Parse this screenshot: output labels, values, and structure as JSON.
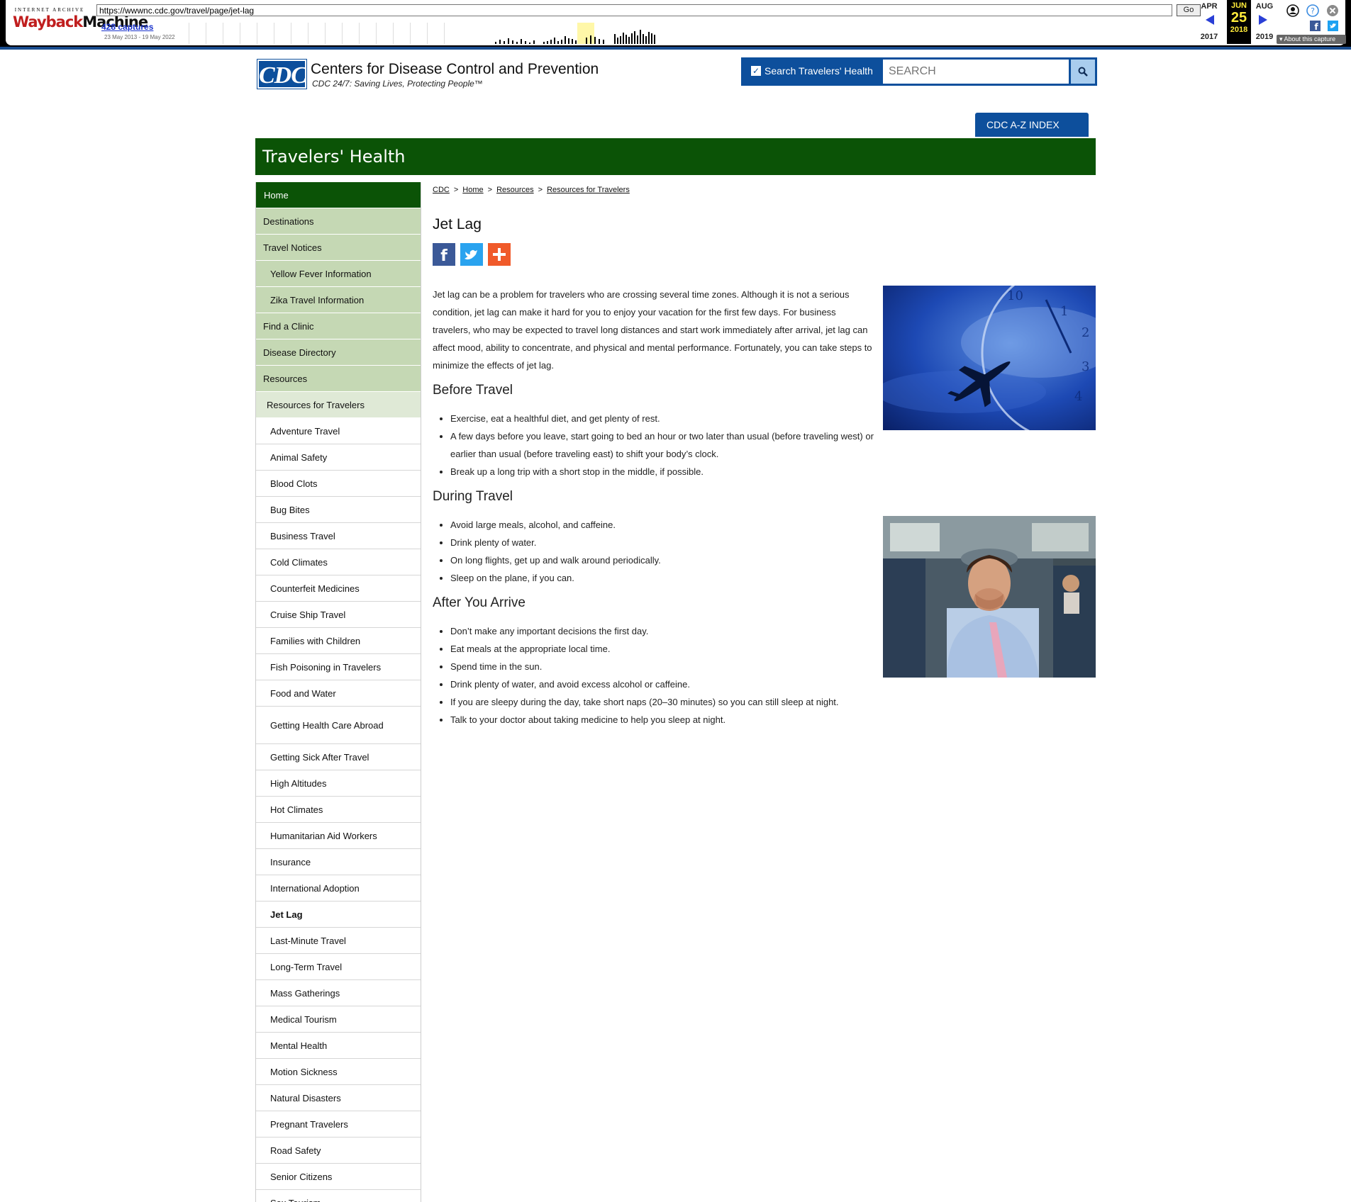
{
  "wayback": {
    "logo_top": "INTERNET ARCHIVE",
    "logo_wayback": "Wayback",
    "logo_machine": "Machine",
    "url": "https://wwwnc.cdc.gov/travel/page/jet-lag",
    "go_label": "Go",
    "captures": "428 captures",
    "range": "23 May 2013 - 19 May 2022",
    "prev_month": "APR",
    "cur_month": "JUN",
    "next_month": "AUG",
    "cur_day": "25",
    "prev_year": "2017",
    "cur_year": "2018",
    "next_year": "2019",
    "about": "About this capture"
  },
  "header": {
    "logo": "CDC",
    "title": "Centers for Disease Control and Prevention",
    "tagline": "CDC 24/7: Saving Lives, Protecting People™",
    "search_checkbox_label": "Search Travelers' Health",
    "search_placeholder": "SEARCH",
    "az_index": "CDC A-Z INDEX",
    "banner": "Travelers' Health"
  },
  "nav": [
    {
      "label": "Home",
      "level": "l1a"
    },
    {
      "label": "Destinations",
      "level": "l1"
    },
    {
      "label": "Travel Notices",
      "level": "l1"
    },
    {
      "label": "Yellow Fever Information",
      "level": "l2"
    },
    {
      "label": "Zika Travel Information",
      "level": "l2"
    },
    {
      "label": "Find a Clinic",
      "level": "l1"
    },
    {
      "label": "Disease Directory",
      "level": "l1"
    },
    {
      "label": "Resources",
      "level": "l1"
    },
    {
      "label": "Resources for Travelers",
      "level": "l2b"
    },
    {
      "label": "Adventure Travel",
      "level": "l3"
    },
    {
      "label": "Animal Safety",
      "level": "l3"
    },
    {
      "label": "Blood Clots",
      "level": "l3"
    },
    {
      "label": "Bug Bites",
      "level": "l3"
    },
    {
      "label": "Business Travel",
      "level": "l3"
    },
    {
      "label": "Cold Climates",
      "level": "l3"
    },
    {
      "label": "Counterfeit Medicines",
      "level": "l3"
    },
    {
      "label": "Cruise Ship Travel",
      "level": "l3"
    },
    {
      "label": "Families with Children",
      "level": "l3"
    },
    {
      "label": "Fish Poisoning in Travelers",
      "level": "l3"
    },
    {
      "label": "Food and Water",
      "level": "l3"
    },
    {
      "label": "Getting Health Care Abroad",
      "level": "l3 tall"
    },
    {
      "label": "Getting Sick After Travel",
      "level": "l3"
    },
    {
      "label": "High Altitudes",
      "level": "l3"
    },
    {
      "label": "Hot Climates",
      "level": "l3"
    },
    {
      "label": "Humanitarian Aid Workers",
      "level": "l3"
    },
    {
      "label": "Insurance",
      "level": "l3"
    },
    {
      "label": "International Adoption",
      "level": "l3"
    },
    {
      "label": "Jet Lag",
      "level": "l3 cur"
    },
    {
      "label": "Last-Minute Travel",
      "level": "l3"
    },
    {
      "label": "Long-Term Travel",
      "level": "l3"
    },
    {
      "label": "Mass Gatherings",
      "level": "l3"
    },
    {
      "label": "Medical Tourism",
      "level": "l3"
    },
    {
      "label": "Mental Health",
      "level": "l3"
    },
    {
      "label": "Motion Sickness",
      "level": "l3"
    },
    {
      "label": "Natural Disasters",
      "level": "l3"
    },
    {
      "label": "Pregnant Travelers",
      "level": "l3"
    },
    {
      "label": "Road Safety",
      "level": "l3"
    },
    {
      "label": "Senior Citizens",
      "level": "l3"
    },
    {
      "label": "Sex Tourism",
      "level": "l3"
    }
  ],
  "breadcrumb": [
    "CDC",
    "Home",
    "Resources",
    "Resources for Travelers"
  ],
  "main": {
    "title": "Jet Lag",
    "intro": "Jet lag can be a problem for travelers who are crossing several time zones. Although it is not a serious condition, jet lag can make it hard for you to enjoy your vacation for the first few days. For business travelers, who may be expected to travel long distances and start work immediately after arrival, jet lag can affect mood, ability to concentrate, and physical and mental performance. Fortunately, you can take steps to minimize the effects of jet lag.",
    "sections": [
      {
        "heading": "Before Travel",
        "items": [
          "Exercise, eat a healthful diet, and get plenty of rest.",
          "A few days before you leave, start going to bed an hour or two later than usual (before traveling west) or earlier than usual (before traveling east) to shift your body’s clock.",
          "Break up a long trip with a short stop in the middle, if possible."
        ]
      },
      {
        "heading": "During Travel",
        "items": [
          "Avoid large meals, alcohol, and caffeine.",
          "Drink plenty of water.",
          "On long flights, get up and walk around periodically.",
          "Sleep on the plane, if you can."
        ]
      },
      {
        "heading": "After You Arrive",
        "items": [
          "Don’t make any important decisions the first day.",
          "Eat meals at the appropriate local time.",
          "Spend time in the sun.",
          "Drink plenty of water, and avoid excess alcohol or caffeine.",
          "If you are sleepy during the day, take short naps (20–30 minutes) so you can still sleep at night.",
          "Talk to your doctor about taking medicine to help you sleep at night."
        ]
      }
    ]
  },
  "colors": {
    "cdc_blue": "#0d4f9c",
    "th_green": "#0b5306",
    "nav_green": "#c5d8b4"
  }
}
